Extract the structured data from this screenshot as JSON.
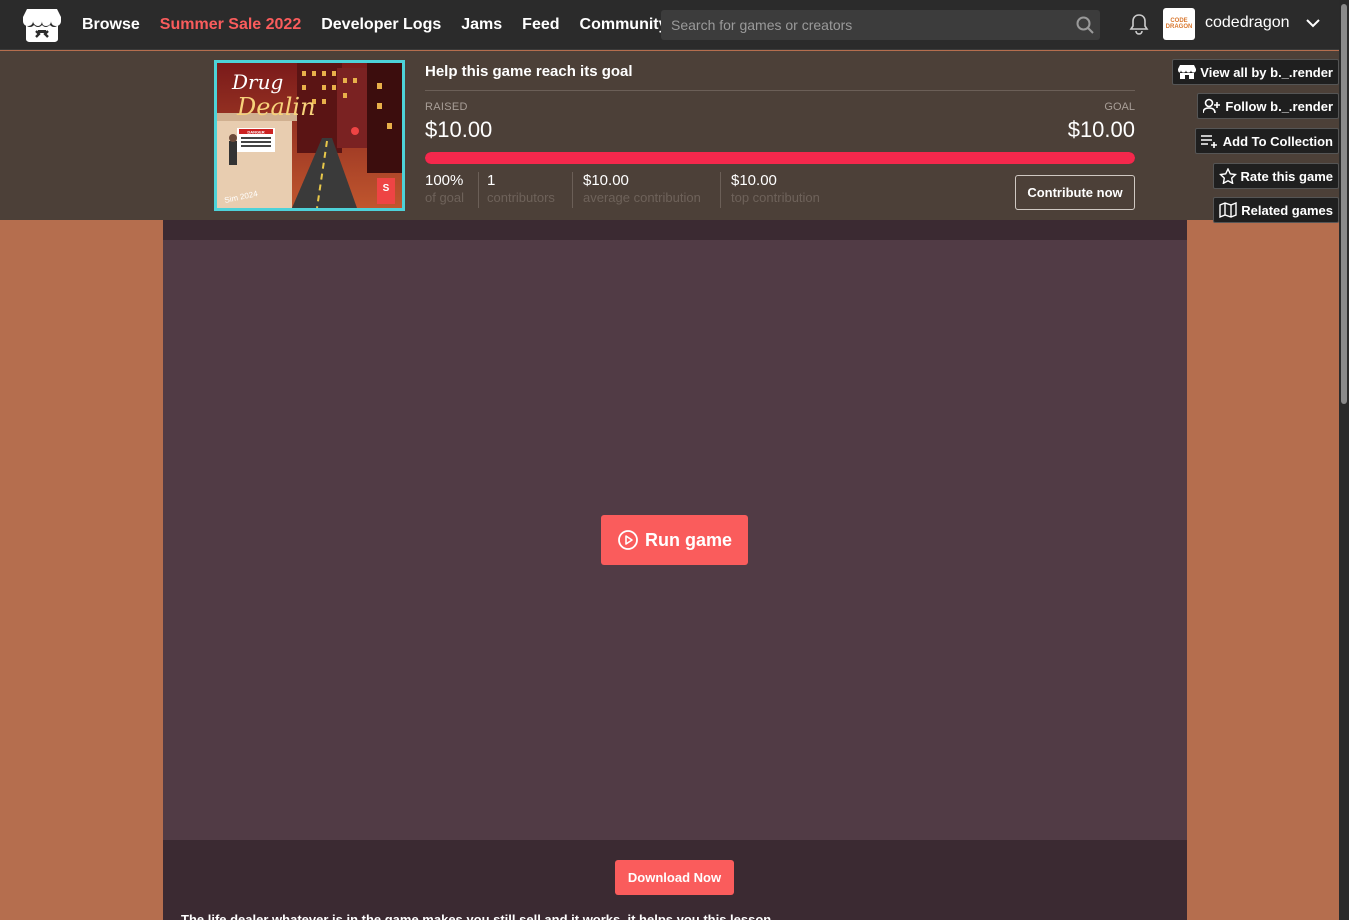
{
  "nav": {
    "links": [
      "Browse",
      "Summer Sale 2022",
      "Developer Logs",
      "Jams",
      "Feed",
      "Community"
    ],
    "search_placeholder": "Search for games or creators",
    "username": "codedragon",
    "avatar_text": "CODE DRAGON"
  },
  "cover": {
    "title_line1": "Drug",
    "title_line2": "Dealin",
    "sign_text": "DANGER",
    "caption": "Sim 2024",
    "badge": "S"
  },
  "funding": {
    "heading": "Help this game reach its goal",
    "raised_label": "RAISED",
    "raised_value": "$10.00",
    "goal_label": "GOAL",
    "goal_value": "$10.00",
    "progress_fraction": 1.0,
    "stats": [
      {
        "value": "100%",
        "label": "of goal"
      },
      {
        "value": "1",
        "label": "contributors"
      },
      {
        "value": "$10.00",
        "label": "average contribution"
      },
      {
        "value": "$10.00",
        "label": "top contribution"
      }
    ],
    "contribute_label": "Contribute now"
  },
  "side_buttons": [
    {
      "label": "View all by b._.render",
      "icon": "storefront-icon"
    },
    {
      "label": "Follow b._.render",
      "icon": "follow-user-icon"
    },
    {
      "label": "Add To Collection",
      "icon": "add-to-list-icon"
    },
    {
      "label": "Rate this game",
      "icon": "star-icon"
    },
    {
      "label": "Related games",
      "icon": "map-icon"
    }
  ],
  "player": {
    "run_label": "Run game"
  },
  "download_label": "Download Now",
  "description_fragment": "The life dealer whatever is in the game makes you still sell and it works, it helps you this lesson."
}
